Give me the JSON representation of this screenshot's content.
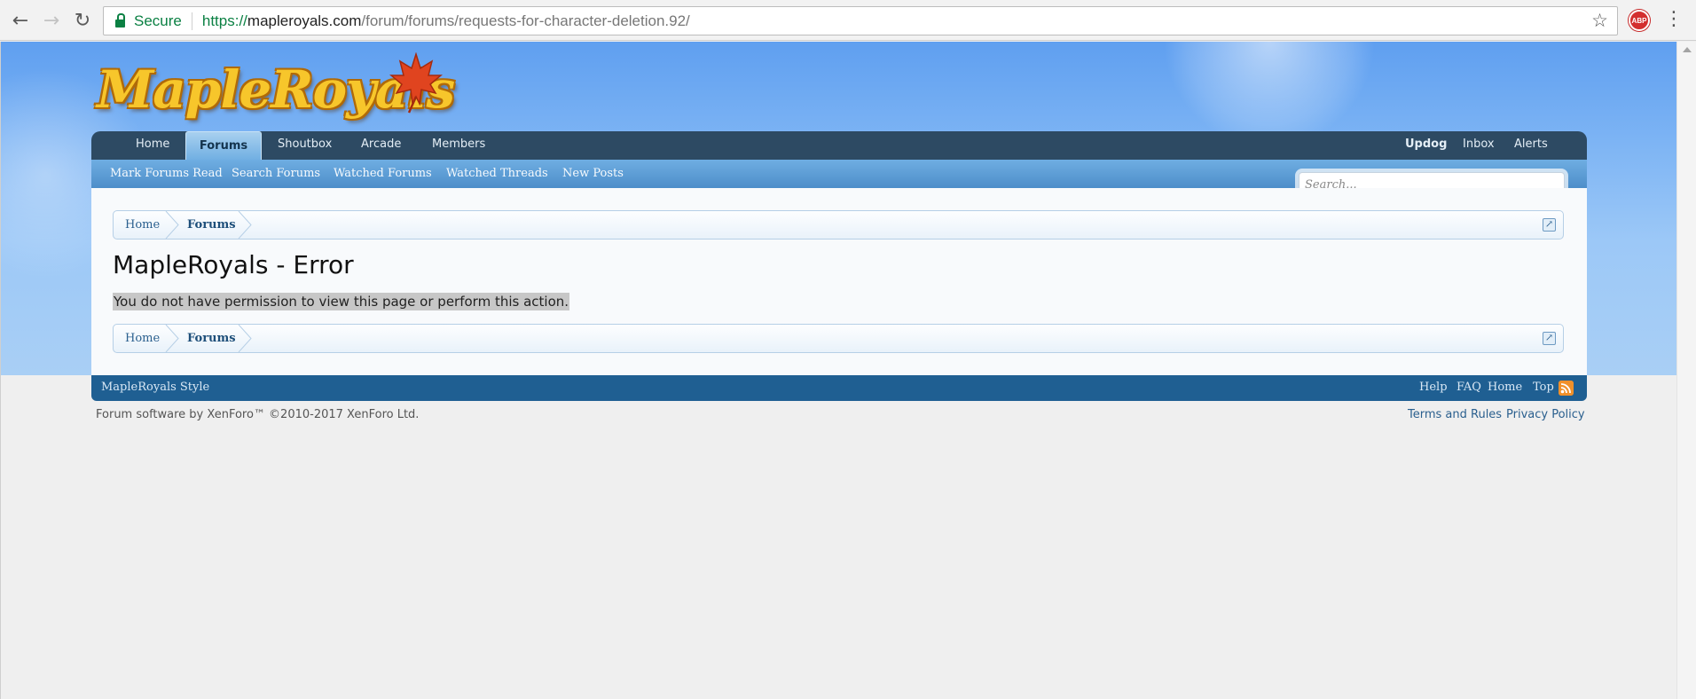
{
  "browser": {
    "secure_label": "Secure",
    "url_scheme": "https://",
    "url_host": "mapleroyals.com",
    "url_path": "/forum/forums/requests-for-character-deletion.92/",
    "abp_label": "ABP"
  },
  "logo": {
    "text": "MapleRoyals"
  },
  "nav": {
    "tabs": [
      {
        "label": "Home"
      },
      {
        "label": "Forums"
      },
      {
        "label": "Shoutbox"
      },
      {
        "label": "Arcade"
      },
      {
        "label": "Members"
      }
    ],
    "user": {
      "username": "Updog",
      "inbox": "Inbox",
      "alerts": "Alerts"
    }
  },
  "subnav": {
    "links": [
      {
        "label": "Mark Forums Read"
      },
      {
        "label": "Search Forums"
      },
      {
        "label": "Watched Forums"
      },
      {
        "label": "Watched Threads"
      },
      {
        "label": "New Posts"
      }
    ]
  },
  "search": {
    "placeholder": "Search..."
  },
  "breadcrumb": {
    "home": "Home",
    "forums": "Forums"
  },
  "main": {
    "title": "MapleRoyals - Error",
    "message": "You do not have permission to view this page or perform this action."
  },
  "footer": {
    "style": "MapleRoyals Style",
    "links": [
      {
        "label": "Help"
      },
      {
        "label": "FAQ"
      },
      {
        "label": "Home"
      },
      {
        "label": "Top"
      }
    ],
    "copyright": "Forum software by XenForo™ ©2010-2017 XenForo Ltd.",
    "terms": "Terms and Rules",
    "privacy": "Privacy Policy"
  },
  "colors": {
    "nav_bg": "#2d4a63",
    "subnav_bg": "#6faee2",
    "footer_bg": "#1f5f92",
    "secure_green": "#0b8043"
  }
}
